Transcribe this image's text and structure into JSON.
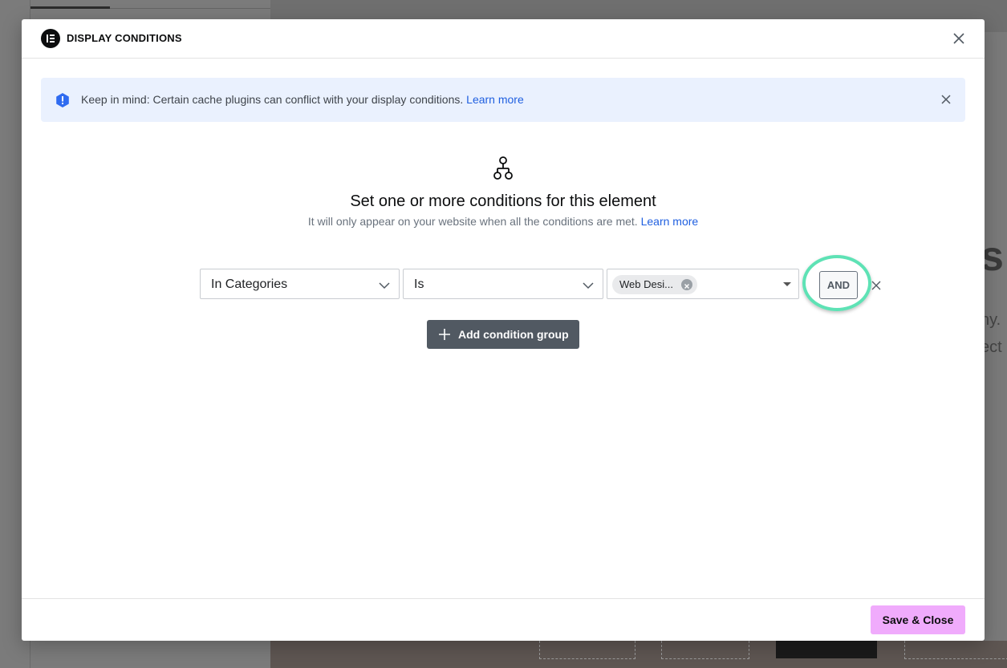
{
  "modal": {
    "title": "DISPLAY CONDITIONS",
    "notice": {
      "text": "Keep in mind: Certain cache plugins can conflict with your display conditions.",
      "link": "Learn more"
    },
    "heading": "Set one or more conditions for this element",
    "subheading": "It will only appear on your website when all the conditions are met.",
    "subheading_link": "Learn more",
    "condition": {
      "field": "In Categories",
      "operator": "Is",
      "value_chip": "Web Desi...",
      "logic_button": "AND"
    },
    "add_group_label": "Add condition group",
    "save_label": "Save & Close"
  },
  "background": {
    "text_s": "s",
    "text_line1": "ny.",
    "text_line2": "ect"
  },
  "colors": {
    "accent_pink": "#f0abfc",
    "highlight_ring": "#5ee2b5",
    "notice_bg": "#eaf1fe",
    "link": "#1f5fe0"
  },
  "icons": [
    "elementor-logo-icon",
    "close-icon",
    "info-icon",
    "sitemap-icon",
    "chevron-down-icon",
    "plus-icon"
  ]
}
